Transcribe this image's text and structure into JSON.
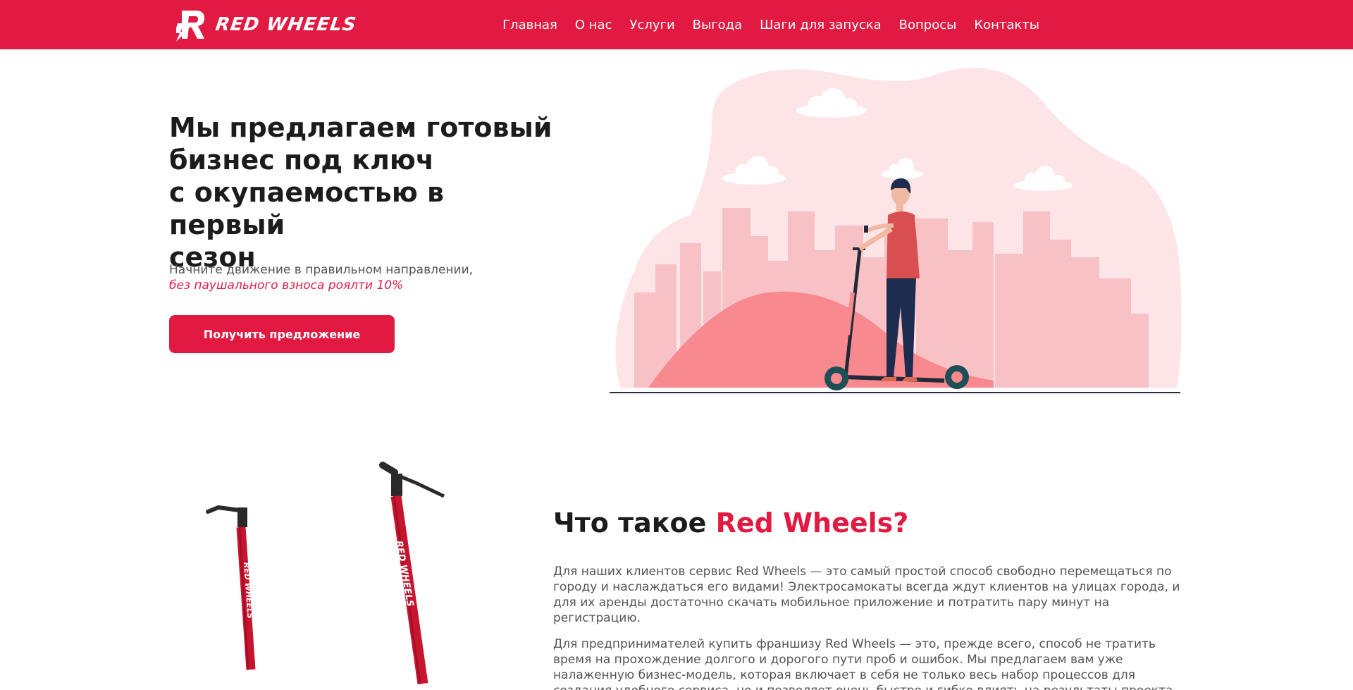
{
  "brand": {
    "name": "RED WHEELS",
    "accent_color": "#e21a42"
  },
  "nav": {
    "items": [
      {
        "label": "Главная"
      },
      {
        "label": "О нас"
      },
      {
        "label": "Услуги"
      },
      {
        "label": "Выгода"
      },
      {
        "label": "Шаги для запуска"
      },
      {
        "label": "Вопросы"
      },
      {
        "label": "Контакты"
      }
    ]
  },
  "hero": {
    "title_line1": "Мы предлагаем готовый",
    "title_line2": "бизнес под ключ",
    "title_line3": "с окупаемостью в первый",
    "title_line4": "сезон",
    "subtitle": "Начните движение в правильном направлении,",
    "subtitle_accent": "без паушального взноса роялти 10%",
    "cta_label": "Получить предложение"
  },
  "about": {
    "title_prefix": "Что такое ",
    "title_accent": "Red Wheels?",
    "paragraph1": "Для наших клиентов сервис Red Wheels — это самый простой способ свободно перемещаться по городу и наслаждаться его видами! Электросамокаты всегда ждут клиентов на улицах города, и для их аренды достаточно скачать мобильное приложение и потратить пару минут на регистрацию.",
    "paragraph2": "Для предпринимателей купить франшизу Red Wheels — это, прежде всего, способ не тратить время на прохождение долгого и дорогого пути проб и ошибок. Мы предлагаем вам уже налаженную бизнес-модель, которая включает в себя не только весь набор процессов для создания удобного сервиса, но и позволяет очень быстро и гибко влиять на результаты проекта в режиме реального"
  },
  "scooter_logo_text": "RED WHEELS"
}
